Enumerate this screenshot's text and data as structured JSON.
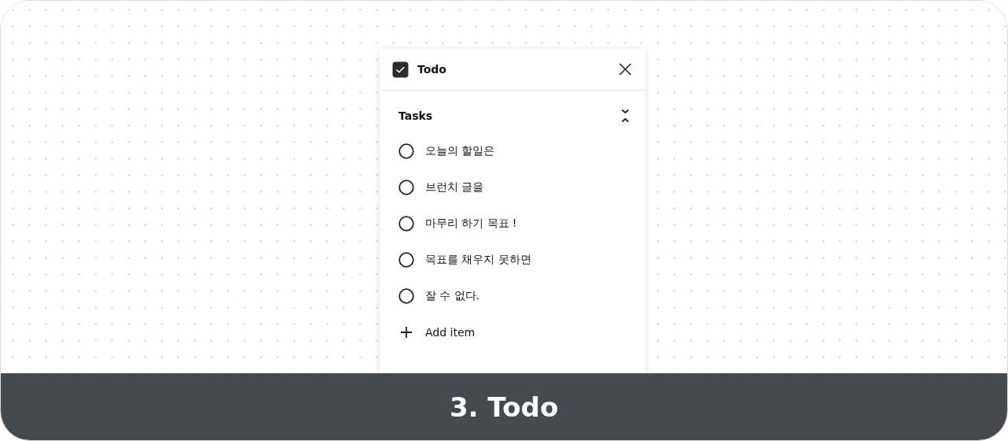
{
  "panel": {
    "title": "Todo",
    "section": "Tasks",
    "tasks": [
      {
        "label": "오늘의 할일은",
        "checked": false
      },
      {
        "label": "브런치 글을",
        "checked": false
      },
      {
        "label": "마무리 하기 목표 !",
        "checked": false
      },
      {
        "label": "목표를 채우지 못하면",
        "checked": false
      },
      {
        "label": "잘 수 없다.",
        "checked": false
      }
    ],
    "add_label": "Add item"
  },
  "caption": "3. Todo"
}
